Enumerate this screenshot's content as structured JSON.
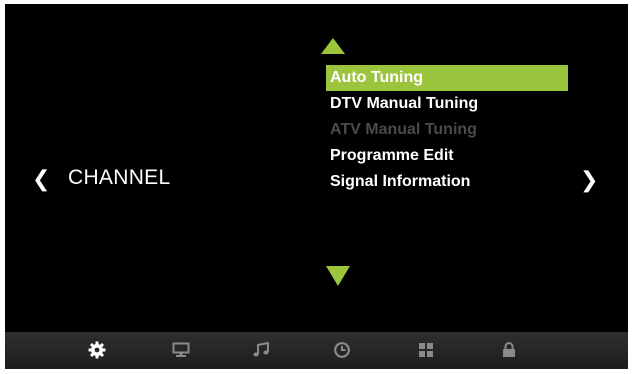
{
  "menu": {
    "category_label": "CHANNEL",
    "items": [
      {
        "label": "Auto Tuning",
        "state": "selected"
      },
      {
        "label": "DTV Manual Tuning",
        "state": "normal"
      },
      {
        "label": "ATV Manual Tuning",
        "state": "disabled"
      },
      {
        "label": "Programme Edit",
        "state": "normal"
      },
      {
        "label": "Signal Information",
        "state": "normal"
      }
    ]
  },
  "nav": {
    "prev_glyph": "❮",
    "next_glyph": "❯"
  },
  "bottom_bar": {
    "icons": [
      "gear-icon",
      "monitor-icon",
      "music-note-icon",
      "clock-icon",
      "apps-grid-icon",
      "lock-icon"
    ],
    "active": "gear-icon"
  },
  "colors": {
    "accent": "#9bc53d",
    "background": "#000000",
    "text": "#ffffff",
    "disabled_text": "#4a4a4a",
    "bar_icon": "#8a8a8a",
    "bar_icon_active": "#ffffff"
  }
}
